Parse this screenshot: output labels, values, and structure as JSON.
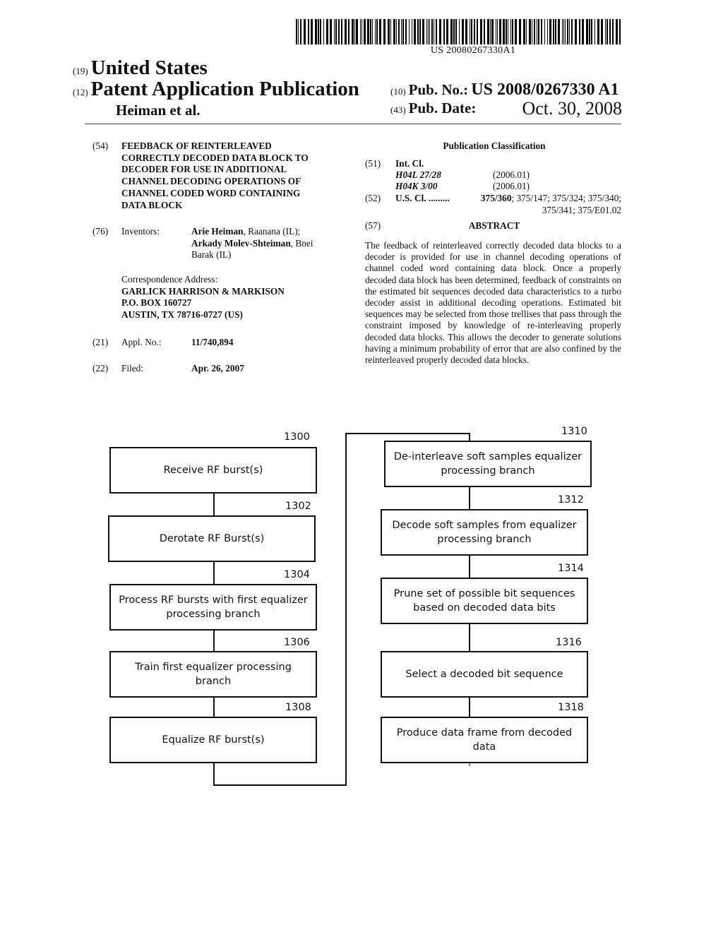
{
  "header": {
    "barcode_number": "US 20080267330A1",
    "country_code": "(19)",
    "country": "United States",
    "doc_type_code": "(12)",
    "doc_type": "Patent Application Publication",
    "applicant": "Heiman et al.",
    "pub_no_code": "(10)",
    "pub_no_label": "Pub. No.:",
    "pub_no": "US 2008/0267330 A1",
    "pub_date_code": "(43)",
    "pub_date_label": "Pub. Date:",
    "pub_date": "Oct. 30, 2008"
  },
  "biblio": {
    "title_code": "(54)",
    "title_lines": [
      "FEEDBACK OF REINTERLEAVED",
      "CORRECTLY DECODED DATA BLOCK TO",
      "DECODER FOR USE IN ADDITIONAL",
      "CHANNEL DECODING OPERATIONS OF",
      "CHANNEL CODED WORD CONTAINING",
      "DATA BLOCK"
    ],
    "inventors_code": "(76)",
    "inventors_label": "Inventors:",
    "inventors": [
      {
        "name": "Arie Heiman",
        "location": ", Raanana (IL);"
      },
      {
        "name": "Arkady Molev-Shteiman",
        "location": ", Bnei"
      },
      {
        "name": "",
        "location": "Barak (IL)"
      }
    ],
    "correspondence_label": "Correspondence Address:",
    "correspondence_lines": [
      "GARLICK HARRISON & MARKISON",
      "P.O. BOX 160727",
      "AUSTIN, TX 78716-0727 (US)"
    ],
    "appl_code": "(21)",
    "appl_label": "Appl. No.:",
    "appl_no": "11/740,894",
    "filed_code": "(22)",
    "filed_label": "Filed:",
    "filed_date": "Apr. 26, 2007"
  },
  "classification": {
    "heading": "Publication Classification",
    "int_cl_code": "(51)",
    "int_cl_label": "Int. Cl.",
    "int_cl": [
      {
        "code": "H04L 27/28",
        "version": "(2006.01)"
      },
      {
        "code": "H04K 3/00",
        "version": "(2006.01)"
      }
    ],
    "us_cl_code": "(52)",
    "us_cl_label": "U.S. Cl. .........",
    "us_cl_primary": "375/360",
    "us_cl_rest_line1": "; 375/147; 375/324; 375/340;",
    "us_cl_rest_line2": "375/341; 375/E01.02"
  },
  "abstract": {
    "code": "(57)",
    "heading": "ABSTRACT",
    "text": "The feedback of reinterleaved correctly decoded data blocks to a decoder is provided for use in channel decoding opera­tions of channel coded word containing data block. Once a properly decoded data block has been determined, feedback of constraints on the estimated bit sequences decoded data characteristics to a turbo decoder assist in additional decod­ing operations. Estimated bit sequences may be selected from those trellises that pass through the constraint imposed by knowledge of re-interleaving properly decoded data blocks. This allows the decoder to generate solutions having a mini­mum probability of error that are also confined by the re­interleaved properly decoded data blocks."
  },
  "flowchart": {
    "left_steps": [
      {
        "ref": "1300",
        "label": "Receive RF burst(s)"
      },
      {
        "ref": "1302",
        "label": "Derotate RF Burst(s)"
      },
      {
        "ref": "1304",
        "label": "Process RF bursts with first equalizer processing branch"
      },
      {
        "ref": "1306",
        "label": "Train first equalizer processing branch"
      },
      {
        "ref": "1308",
        "label": "Equalize RF burst(s)"
      }
    ],
    "right_steps": [
      {
        "ref": "1310",
        "label": "De-interleave soft samples equalizer processing branch"
      },
      {
        "ref": "1312",
        "label": "Decode soft samples from equalizer processing branch"
      },
      {
        "ref": "1314",
        "label": "Prune set of possible bit sequences based on decoded data bits"
      },
      {
        "ref": "1316",
        "label": "Select a decoded bit sequence"
      },
      {
        "ref": "1318",
        "label": "Produce data frame from decoded data"
      }
    ]
  }
}
